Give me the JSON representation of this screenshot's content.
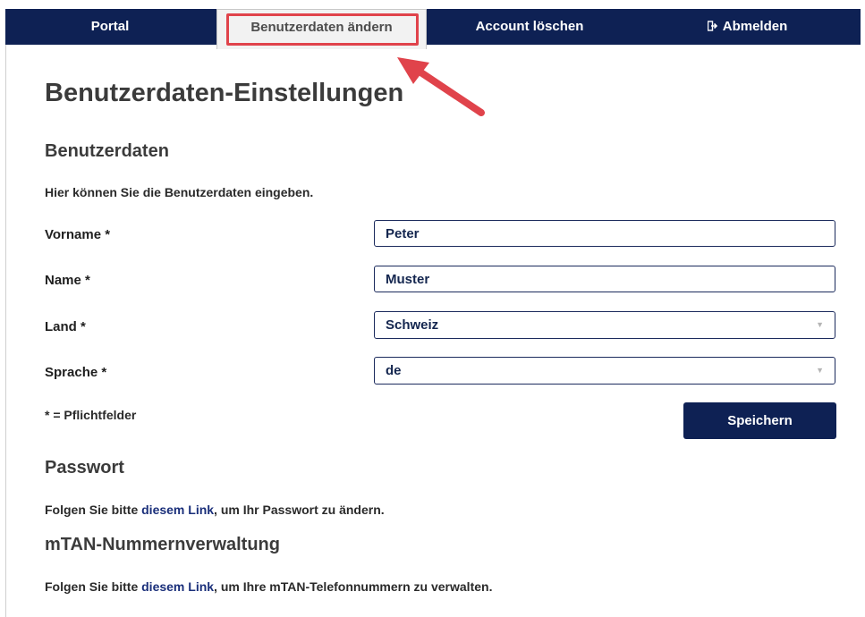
{
  "nav": {
    "tabs": [
      {
        "label": "Portal"
      },
      {
        "label": "Benutzerdaten ändern"
      },
      {
        "label": "Account löschen"
      },
      {
        "label": "Abmelden",
        "icon": "logout-icon"
      }
    ],
    "active_index": 1
  },
  "page": {
    "title": "Benutzerdaten-Einstellungen"
  },
  "user_section": {
    "title": "Benutzerdaten",
    "intro": "Hier können Sie die Benutzerdaten eingeben.",
    "fields": {
      "first_name": {
        "label": "Vorname *",
        "value": "Peter"
      },
      "last_name": {
        "label": "Name *",
        "value": "Muster"
      },
      "country": {
        "label": "Land *",
        "value": "Schweiz"
      },
      "language": {
        "label": "Sprache *",
        "value": "de"
      }
    },
    "required_note": "* = Pflichtfelder",
    "save_label": "Speichern"
  },
  "password_section": {
    "title": "Passwort",
    "text_before": "Folgen Sie bitte ",
    "link": "diesem Link",
    "text_after": ", um Ihr Passwort zu ändern."
  },
  "mtan_section": {
    "title": "mTAN-Nummernverwaltung",
    "text_before": "Folgen Sie bitte ",
    "link": "diesem Link",
    "text_after": ", um Ihre mTAN-Telefonnummern zu verwalten."
  },
  "colors": {
    "nav_bg": "#0e2154",
    "annotation": "#e0434b",
    "link": "#1a2f7a"
  }
}
